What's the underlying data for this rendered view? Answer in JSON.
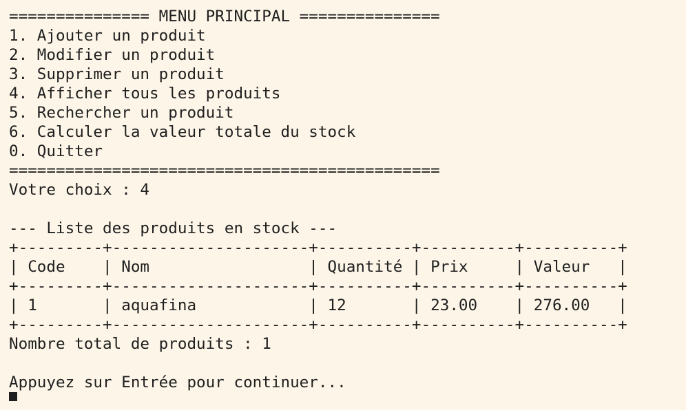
{
  "terminal": {
    "menu": {
      "header": "=============== MENU PRINCIPAL ===============",
      "items": [
        "1. Ajouter un produit",
        "2. Modifier un produit",
        "3. Supprimer un produit",
        "4. Afficher tous les produits",
        "5. Rechercher un produit",
        "6. Calculer la valeur totale du stock",
        "0. Quitter"
      ],
      "footer": "=============================================="
    },
    "prompt": "Votre choix : 4",
    "list_title": "--- Liste des produits en stock ---",
    "table": {
      "border": "+---------+---------------------+----------+----------+----------+",
      "header_row": "| Code    | Nom                 | Quantité | Prix     | Valeur   |",
      "rows": [
        "| 1       | aquafina            | 12       | 23.00    | 276.00   |"
      ]
    },
    "total": "Nombre total de produits : 1",
    "continue_prompt": "Appuyez sur Entrée pour continuer..."
  }
}
